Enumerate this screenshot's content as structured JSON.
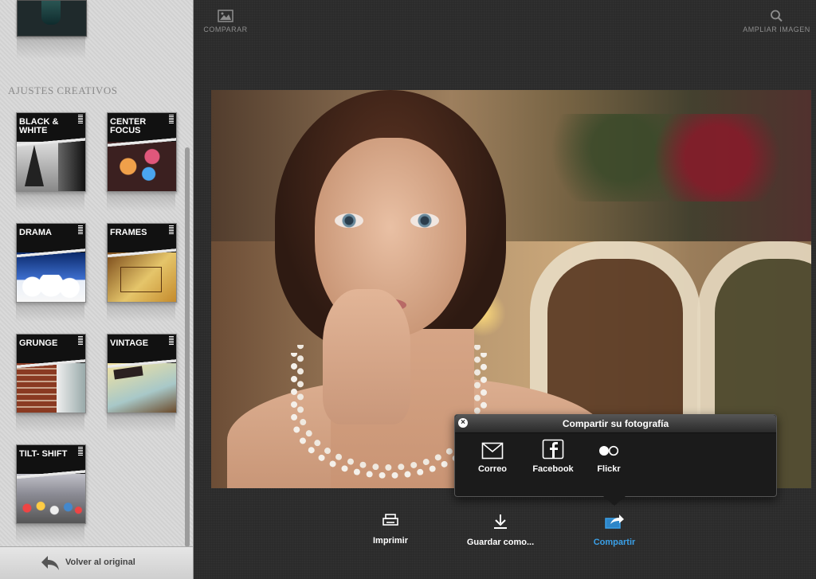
{
  "sidebar": {
    "section_title": "AJUSTES CREATIVOS",
    "effects": [
      {
        "label": "BLACK & WHITE"
      },
      {
        "label": "CENTER FOCUS"
      },
      {
        "label": "DRAMA"
      },
      {
        "label": "FRAMES"
      },
      {
        "label": "GRUNGE"
      },
      {
        "label": "VINTAGE"
      },
      {
        "label": "TILT- SHIFT"
      }
    ],
    "back_label": "Volver al original"
  },
  "toolbar": {
    "compare_label": "COMPARAR",
    "zoom_label": "AMPLIAR IMAGEN"
  },
  "share_popup": {
    "title": "Compartir su fotografía",
    "options": [
      {
        "label": "Correo",
        "icon": "mail-icon"
      },
      {
        "label": "Facebook",
        "icon": "facebook-icon"
      },
      {
        "label": "Flickr",
        "icon": "flickr-icon"
      }
    ]
  },
  "actions": [
    {
      "label": "Imprimir",
      "icon": "printer-icon"
    },
    {
      "label": "Guardar como...",
      "icon": "download-icon"
    },
    {
      "label": "Compartir",
      "icon": "share-icon",
      "active": true
    }
  ],
  "colors": {
    "accent": "#3aa0e8",
    "sidebar_bg": "#d8d8d8",
    "main_bg": "#2b2b2b"
  }
}
